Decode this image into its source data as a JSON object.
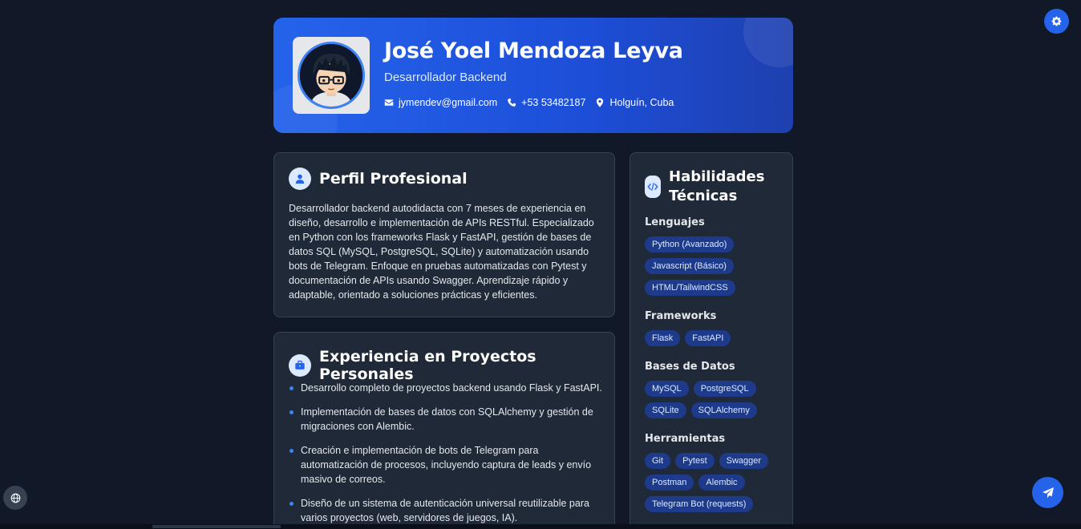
{
  "header": {
    "name": "José Yoel Mendoza Leyva",
    "role": "Desarrollador Backend",
    "email": "jymendev@gmail.com",
    "phone": "+53 53482187",
    "location": "Holguín, Cuba"
  },
  "perfil": {
    "title": "Perfil Profesional",
    "text": "Desarrollador backend autodidacta con 7 meses de experiencia en diseño, desarrollo e implementación de APIs RESTful. Especializado en Python con los frameworks Flask y FastAPI, gestión de bases de datos SQL (MySQL, PostgreSQL, SQLite) y automatización usando bots de Telegram. Enfoque en pruebas automatizadas con Pytest y documentación de APIs usando Swagger. Aprendizaje rápido y adaptable, orientado a soluciones prácticas y eficientes."
  },
  "experiencia": {
    "title": "Experiencia en Proyectos Personales",
    "items": [
      "Desarrollo completo de proyectos backend usando Flask y FastAPI.",
      "Implementación de bases de datos con SQLAlchemy y gestión de migraciones con Alembic.",
      "Creación e implementación de bots de Telegram para automatización de procesos, incluyendo captura de leads y envío masivo de correos.",
      "Diseño de un sistema de autenticación universal reutilizable para varios proyectos (web, servidores de juegos, IA)."
    ]
  },
  "habilidades": {
    "title_line1": "Habilidades",
    "title_line2": "Técnicas",
    "groups": [
      {
        "heading": "Lenguajes",
        "tags": [
          "Python (Avanzado)",
          "Javascript (Básico)",
          "HTML/TailwindCSS"
        ]
      },
      {
        "heading": "Frameworks",
        "tags": [
          "Flask",
          "FastAPI"
        ]
      },
      {
        "heading": "Bases de Datos",
        "tags": [
          "MySQL",
          "PostgreSQL",
          "SQLite",
          "SQLAlchemy"
        ]
      },
      {
        "heading": "Herramientas",
        "tags": [
          "Git",
          "Pytest",
          "Swagger",
          "Postman",
          "Alembic",
          "Telegram Bot (requests)"
        ]
      }
    ]
  },
  "colors": {
    "background": "#111827",
    "card": "#1f2937",
    "accent": "#2563eb",
    "tag_bg": "#1e3a8a"
  },
  "icons": {
    "settings": "gear-icon",
    "language": "globe-icon",
    "contact": "paper-plane-icon"
  }
}
